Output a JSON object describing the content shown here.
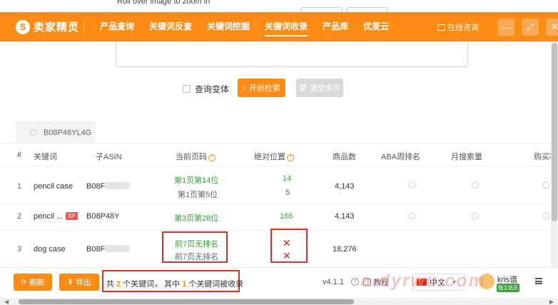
{
  "background": {
    "caption": "Roll over image to zoom in"
  },
  "header": {
    "logo_mark": "S",
    "logo_text": "卖家精灵",
    "nav": [
      {
        "label": "产品查询"
      },
      {
        "label": "关键词反查"
      },
      {
        "label": "关键词挖掘"
      },
      {
        "label": "关键词收录",
        "active": true
      },
      {
        "label": "产品库"
      },
      {
        "label": "优麦云"
      }
    ],
    "consult_label": "在线咨询",
    "window_buttons": [
      "minimize-icon",
      "expand-icon",
      "close-icon"
    ]
  },
  "search": {
    "variant_label": "查询变体",
    "search_button": "开始检索",
    "clear_button": "清空条件"
  },
  "tab": {
    "asin": "B08P48YL4G"
  },
  "table": {
    "headers": {
      "index": "#",
      "keyword": "关键词",
      "child_asin": "子ASIN",
      "current_page": "当前页码",
      "absolute_position": "绝对位置",
      "product_count": "商品数",
      "aba_rank": "ABA周排名",
      "monthly_search": "月搜索量",
      "buy": "购买率"
    },
    "rows": [
      {
        "index": "1",
        "keyword": "pencil case",
        "child_asin": "B08F",
        "page_line1": "第1页第14位",
        "page_line2": "第1页第5位",
        "pos_line1": "14",
        "pos_line2": "5",
        "product_count": "4,143"
      },
      {
        "index": "2",
        "keyword": "pencil ...",
        "badge": "SP",
        "child_asin": "B08P48Y",
        "page_line1": "第3页第28位",
        "pos_line1": "166",
        "product_count": "4,143"
      },
      {
        "index": "3",
        "keyword": "dog case",
        "child_asin": "B08F",
        "page_line1": "前7页无排名",
        "page_line2": "前7页无排名",
        "pos_mark": "✕",
        "product_count": "18,276"
      }
    ]
  },
  "footer": {
    "refresh_button": "刷新",
    "export_button": "导出",
    "summary": {
      "prefix": "共",
      "total": "2",
      "mid": "个关键词， 其中",
      "indexed": "1",
      "suffix": "个关键词被收录"
    },
    "version": "v4.1.1",
    "tutorial": "教程",
    "language": "中文",
    "user_name": "kris谱",
    "user_badge": "独立站员",
    "watermark": "a.dyrwu.com"
  },
  "colors": {
    "brand": "#fb8b13",
    "green": "#3aa23a",
    "red": "#e0302a"
  }
}
